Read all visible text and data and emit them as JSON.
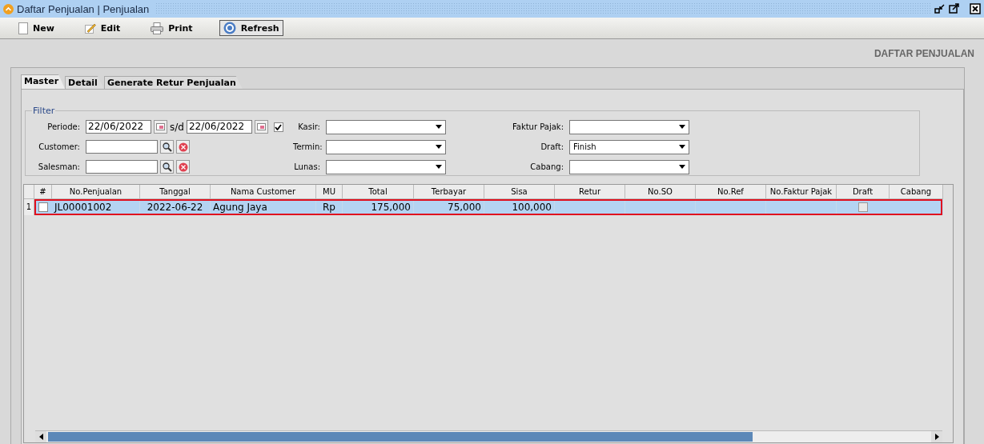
{
  "window": {
    "title": "Daftar Penjualan | Penjualan"
  },
  "toolbar": [
    {
      "label": "New",
      "kind": "new",
      "selected": false
    },
    {
      "label": "Edit",
      "kind": "edit",
      "selected": false
    },
    {
      "label": "Print",
      "kind": "print",
      "selected": false
    },
    {
      "label": "Refresh",
      "kind": "refresh",
      "selected": true
    }
  ],
  "page_title": "DAFTAR PENJUALAN",
  "tabs": [
    {
      "label": "Master",
      "selected": true
    },
    {
      "label": "Detail",
      "selected": false
    },
    {
      "label": "Generate Retur Penjualan",
      "selected": false
    }
  ],
  "filter": {
    "title": "Filter",
    "periode": {
      "label": "Periode:",
      "from": "22/06/2022",
      "separator": "s/d",
      "to": "22/06/2022",
      "checked": true
    },
    "lookups": [
      {
        "label": "Customer:"
      },
      {
        "label": "Salesman:"
      }
    ],
    "combos_1": [
      {
        "label": "Kasir:"
      },
      {
        "label": "Termin:"
      },
      {
        "label": "Lunas:"
      }
    ],
    "combos_2": [
      {
        "label": "Faktur Pajak:"
      },
      {
        "label": "Draft:",
        "value": "Finish"
      },
      {
        "label": "Cabang:"
      }
    ]
  },
  "table": {
    "check_column": "#",
    "columns": [
      "No.Penjualan",
      "Tanggal",
      "Nama Customer",
      "MU",
      "Total",
      "Terbayar",
      "Sisa",
      "Retur",
      "No.SO",
      "No.Ref",
      "No.Faktur Pajak",
      "Draft",
      "Cabang"
    ],
    "rows": [
      {
        "row_number": "1",
        "checked": false,
        "selected": true,
        "highlighted": true,
        "cells": [
          "JL00001002",
          "2022-06-22",
          "Agung Jaya",
          "Rp",
          "175,000",
          "75,000",
          "100,000",
          "",
          "",
          "",
          "",
          "",
          ""
        ],
        "draft": false
      }
    ]
  }
}
